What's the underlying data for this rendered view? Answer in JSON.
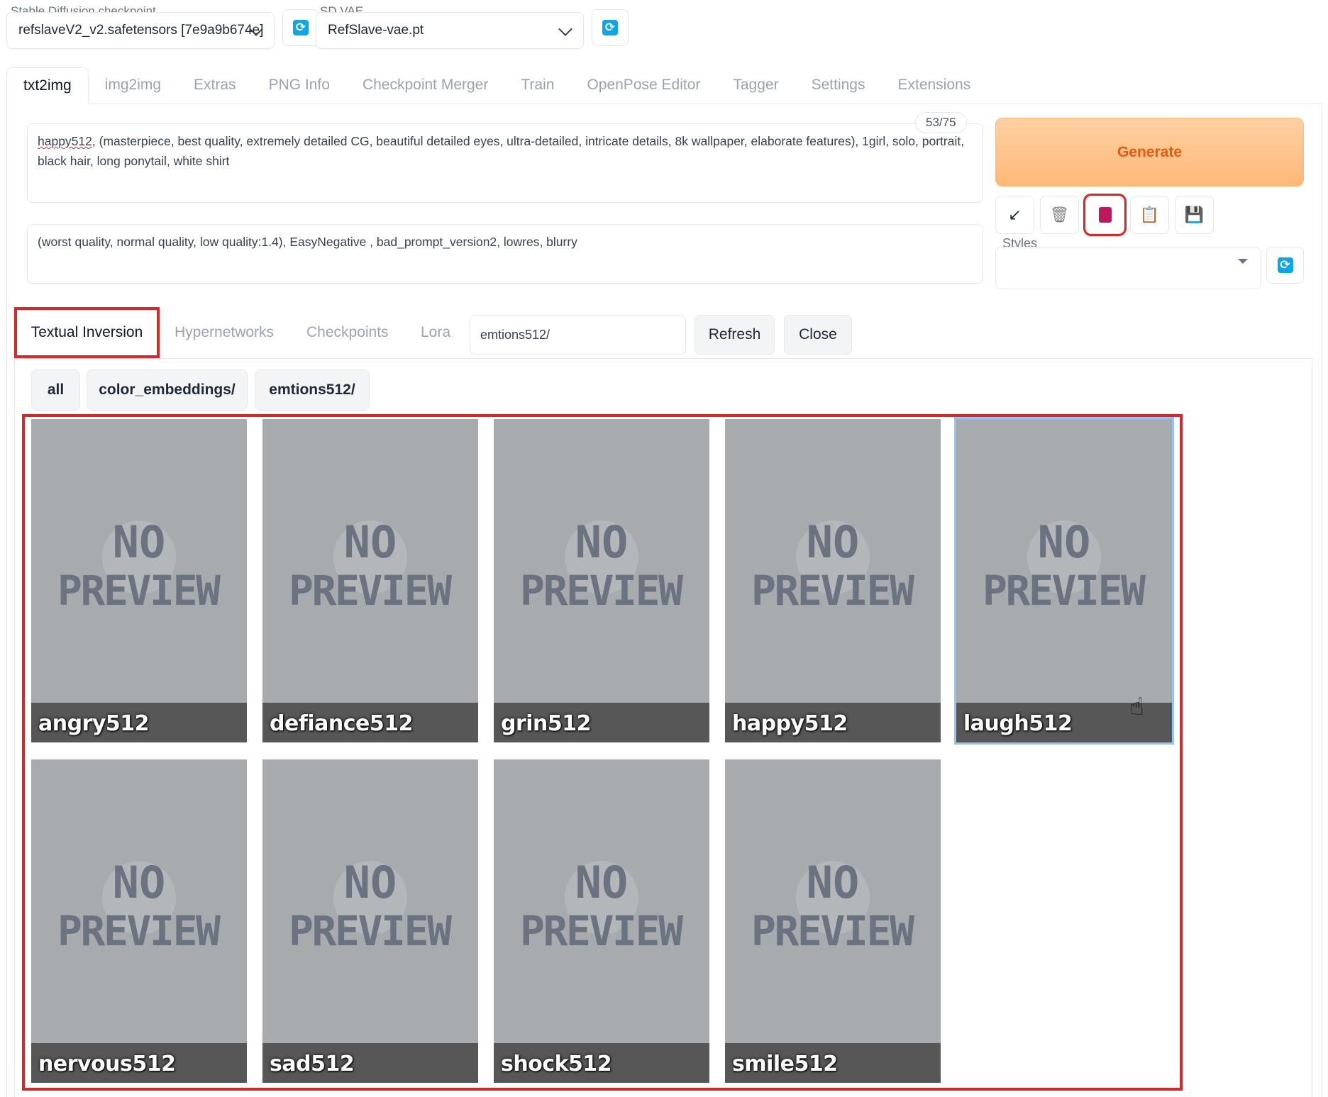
{
  "checkpoint": {
    "label": "Stable Diffusion checkpoint",
    "value": "refslaveV2_v2.safetensors [7e9a9b674e]"
  },
  "vae": {
    "label": "SD VAE",
    "value": "RefSlave-vae.pt"
  },
  "main_tabs": [
    "txt2img",
    "img2img",
    "Extras",
    "PNG Info",
    "Checkpoint Merger",
    "Train",
    "OpenPose Editor",
    "Tagger",
    "Settings",
    "Extensions"
  ],
  "prompt": {
    "token_count": "53/75",
    "first_word": "happy512",
    "rest": ", (masterpiece, best quality, extremely detailed CG, beautiful detailed eyes, ultra-detailed, intricate details, 8k wallpaper, elaborate features), 1girl, solo, portrait, black hair,  long ponytail, white shirt"
  },
  "negative_prompt": "(worst quality, normal quality, low quality:1.4), EasyNegative , bad_prompt_version2, lowres, blurry",
  "generate_label": "Generate",
  "tools": [
    {
      "name": "read-params-button",
      "glyph": "↙"
    },
    {
      "name": "clear-prompt-button",
      "glyph": "🗑"
    },
    {
      "name": "extra-networks-button",
      "glyph": "🎴"
    },
    {
      "name": "apply-style-button",
      "glyph": "📋"
    },
    {
      "name": "save-style-button",
      "glyph": "💾"
    }
  ],
  "styles_label": "Styles",
  "network_tabs": [
    "Textual Inversion",
    "Hypernetworks",
    "Checkpoints",
    "Lora"
  ],
  "search_value": "emtions512/",
  "refresh_label": "Refresh",
  "close_label": "Close",
  "folder_chips": [
    "all",
    "color_embeddings/",
    "emtions512/"
  ],
  "preview_text": {
    "line1": "NO",
    "line2": "PREVIEW"
  },
  "cards": [
    "angry512",
    "defiance512",
    "grin512",
    "happy512",
    "laugh512",
    "nervous512",
    "sad512",
    "shock512",
    "smile512"
  ],
  "refresh_icon": "refresh-icon",
  "accent_color": "#dc2626",
  "generate_color": "#ea580c"
}
